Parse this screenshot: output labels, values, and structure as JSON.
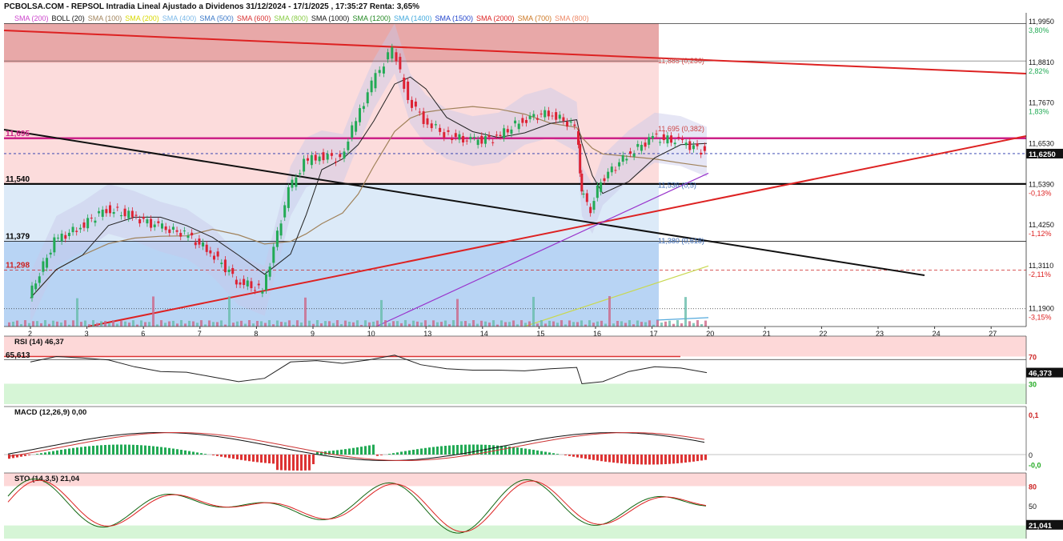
{
  "header": "PCBOLSA.COM - REPSOL Intradia Lineal Ajustado a Dividenos 31/12/2024 - 17/1/2025 , 17:35:27 Renta: 3,65%",
  "legend": [
    {
      "label": "SMA (200)",
      "color": "#cc44cc"
    },
    {
      "label": "BOLL (20)",
      "color": "#111111"
    },
    {
      "label": "SMA (100)",
      "color": "#a0825a"
    },
    {
      "label": "SMA (200)",
      "color": "#d8d800"
    },
    {
      "label": "SMA (400)",
      "color": "#7ab8e8"
    },
    {
      "label": "SMA (500)",
      "color": "#3a78c8"
    },
    {
      "label": "SMA (600)",
      "color": "#d83030"
    },
    {
      "label": "SMA (800)",
      "color": "#88cc44"
    },
    {
      "label": "SMA (1000)",
      "color": "#111111"
    },
    {
      "label": "SMA (1200)",
      "color": "#228822"
    },
    {
      "label": "SMA (1400)",
      "color": "#44aadd"
    },
    {
      "label": "SMA (1500)",
      "color": "#2244cc"
    },
    {
      "label": "SMA (2000)",
      "color": "#dd2222"
    },
    {
      "label": "SMA (700)",
      "color": "#cc7722"
    },
    {
      "label": "SMA (800)",
      "color": "#ee8866"
    }
  ],
  "chart_data": [
    {
      "type": "line",
      "title": "REPSOL Intradia",
      "x_ticks": [
        "2",
        "3",
        "6",
        "7",
        "8",
        "9",
        "10",
        "13",
        "14",
        "15",
        "16",
        "17",
        "20",
        "21",
        "22",
        "23",
        "24",
        "27"
      ],
      "y_ticks": [
        "11,9950",
        "11,8810",
        "11,7670",
        "11,6530",
        "11,5390",
        "11,4250",
        "11,3110",
        "11,1900"
      ],
      "pct_labels": [
        "3,80%",
        "2,82%",
        "1,83%",
        "0,84%",
        "-0,13%",
        "-1,12%",
        "-2,11%",
        "-3,15%"
      ],
      "ylim": [
        11.14,
        12.02
      ],
      "last_price": "11,6250",
      "levels": [
        {
          "label": "11,695",
          "value": 11.668,
          "color": "#cc2288"
        },
        {
          "label": "11,540",
          "value": 11.54,
          "color": "#000000"
        },
        {
          "label": "11,379",
          "value": 11.379,
          "color": "#000000"
        },
        {
          "label": "11,298",
          "value": 11.298,
          "color": "#cc2222"
        }
      ],
      "fib_labels": [
        {
          "label": "11,885 (0,236)",
          "value": 11.885
        },
        {
          "label": "11,695 (0,382)",
          "value": 11.695
        },
        {
          "label": "11,536 (0,5)",
          "value": 11.536
        },
        {
          "label": "11,380 (0,618)",
          "value": 11.38
        }
      ],
      "series": [
        {
          "name": "",
          "x": [
            0.0,
            0.5,
            1.0,
            1.5,
            2.0,
            2.5,
            3.0,
            3.5,
            4.0,
            4.5,
            5.0,
            5.3,
            5.6,
            6.0,
            6.3,
            6.6,
            7.0,
            7.3,
            7.6,
            8.0,
            8.5,
            9.0,
            9.5,
            10.0,
            10.5,
            10.6,
            10.8,
            11.0,
            11.5,
            12.0,
            12.5,
            13.0
          ],
          "close": [
            11.22,
            11.38,
            11.42,
            11.47,
            11.45,
            11.42,
            11.4,
            11.35,
            11.27,
            11.24,
            11.52,
            11.6,
            11.62,
            11.61,
            11.72,
            11.82,
            11.92,
            11.78,
            11.72,
            11.68,
            11.66,
            11.67,
            11.72,
            11.74,
            11.7,
            11.52,
            11.47,
            11.55,
            11.62,
            11.67,
            11.66,
            11.63
          ]
        }
      ]
    },
    {
      "type": "line",
      "title": "RSI (14)",
      "value_label": "46,37",
      "level_label": "65,613",
      "y_ticks": [
        "70",
        "30"
      ],
      "last_value": "46,373",
      "ylim": [
        0,
        100
      ],
      "x": [
        0,
        0.5,
        1,
        1.5,
        2,
        2.5,
        3,
        3.5,
        4,
        4.5,
        5,
        5.5,
        6,
        6.5,
        7,
        7.5,
        8,
        8.5,
        9,
        9.5,
        10,
        10.5,
        10.6,
        11,
        11.5,
        12,
        12.5,
        13
      ],
      "values": [
        62,
        70,
        68,
        65,
        55,
        48,
        47,
        40,
        33,
        38,
        62,
        64,
        60,
        65,
        72,
        58,
        52,
        50,
        50,
        49,
        52,
        54,
        30,
        33,
        48,
        55,
        53,
        46.4
      ]
    },
    {
      "type": "bar",
      "title": "MACD (12,26,9)",
      "value_label": "0,00",
      "y_ticks": [
        "0,1",
        "0",
        "-0,0"
      ],
      "ylim": [
        -0.04,
        0.12
      ]
    },
    {
      "type": "line",
      "title": "STO (14,3,5)",
      "value_label": "21,04",
      "y_ticks": [
        "80",
        "50"
      ],
      "last_value": "21,041",
      "ylim": [
        0,
        100
      ]
    }
  ]
}
